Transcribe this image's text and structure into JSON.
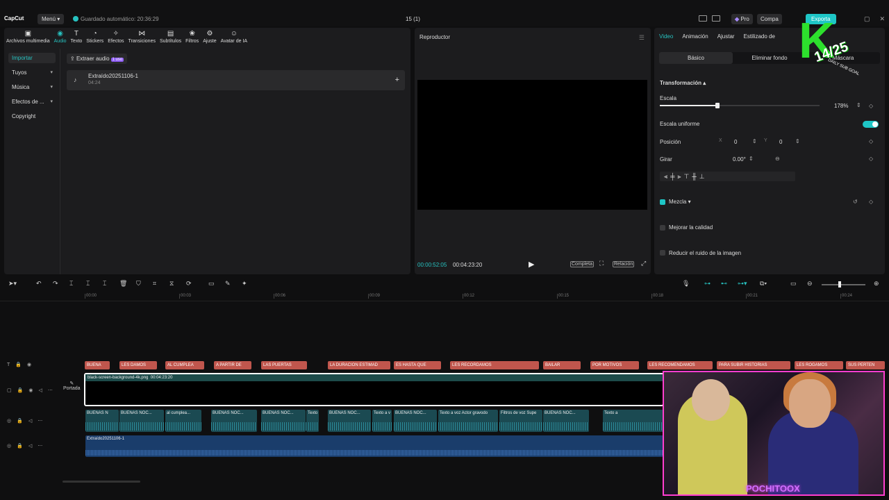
{
  "app": {
    "logo": "CapCut",
    "menu": "Menú",
    "autosave": "Guardado automático: 20:36:29",
    "project": "15 (1)",
    "pro": "Pro",
    "share": "Compa",
    "export": "Exporta"
  },
  "toolbar": [
    {
      "label": "Archivos multimedia",
      "icon": "media-icon"
    },
    {
      "label": "Audio",
      "icon": "audio-icon"
    },
    {
      "label": "Texto",
      "icon": "text-icon"
    },
    {
      "label": "Stickers",
      "icon": "sticker-icon"
    },
    {
      "label": "Efectos",
      "icon": "effects-icon"
    },
    {
      "label": "Transiciones",
      "icon": "transitions-icon"
    },
    {
      "label": "Subtítulos",
      "icon": "subtitles-icon"
    },
    {
      "label": "Filtros",
      "icon": "filters-icon"
    },
    {
      "label": "Ajuste",
      "icon": "adjust-icon"
    },
    {
      "label": "Avatar de IA",
      "icon": "avatar-icon"
    }
  ],
  "sidebar": [
    "Importar",
    "Tuyos",
    "Música",
    "Efectos de ...",
    "Copyright"
  ],
  "media": {
    "extract": "Extraer audio",
    "extract_badge": "1 uso",
    "item_name": "Extraído20251106-1",
    "item_duration": "04:24"
  },
  "player": {
    "title": "Reproductor",
    "current": "00:00:52:05",
    "total": "00:04:23:20",
    "full": "Completa",
    "ratio": "Relación"
  },
  "props": {
    "tabs": [
      "Video",
      "Animación",
      "Ajustar",
      "Estilizado de"
    ],
    "subtabs": [
      "Básico",
      "Eliminar fondo",
      "Máscara"
    ],
    "transform": "Transformación",
    "scale_label": "Escala",
    "scale_value": "178%",
    "scale_fraction": 0.36,
    "uniform": "Escala uniforme",
    "position": "Posición",
    "pos_x_label": "X",
    "pos_x": "0",
    "pos_y_label": "Y",
    "pos_y": "0",
    "rotate": "Girar",
    "rotate_value": "0.00°",
    "mix": "Mezcla",
    "improve": "Mejorar la calidad",
    "noise": "Reducir el ruido de la imagen"
  },
  "ruler": [
    "00:00",
    "00:03",
    "00:06",
    "00:09",
    "00:12",
    "00:15",
    "00:18",
    "00:21",
    "00:24"
  ],
  "text_clips": [
    "BUENA",
    "LES DAMOS",
    "AL CUMPLEA",
    "A PARTIR DE",
    "LAS PUERTAS",
    "LA DURACION ESTIMAD",
    "ES HASTA QUE",
    "LES RECORDAMOS",
    "BAILAR",
    "POR MOTIVOS",
    "LES RECOMENDAMOS",
    "PARA SUBIR HISTORIAS",
    "LES ROGAMOS",
    "SUS PERTEN"
  ],
  "video_clip": {
    "name": "black-screen-background-4k.png",
    "duration": "00:04:23:20"
  },
  "cover_label": "Portada",
  "audio_clips": [
    "BUENAS N",
    "BUENAS NOC...",
    "al cumplea...",
    "BUENAS NOC...",
    "BUENAS NOC...",
    "Texto",
    "BUENAS NOC...",
    "Texto a v",
    "BUENAS NOC...",
    "Texto a voz Actor gravodo",
    "Filtros de voz Supe",
    "BUENAS NOC...",
    "Texto a"
  ],
  "main_audio": "Extraído20251106-1",
  "stream_overlay": {
    "goal_count": "14/25",
    "goal_label": "DAILY SUB GOAL",
    "cam_name": "POCHITOOX"
  }
}
